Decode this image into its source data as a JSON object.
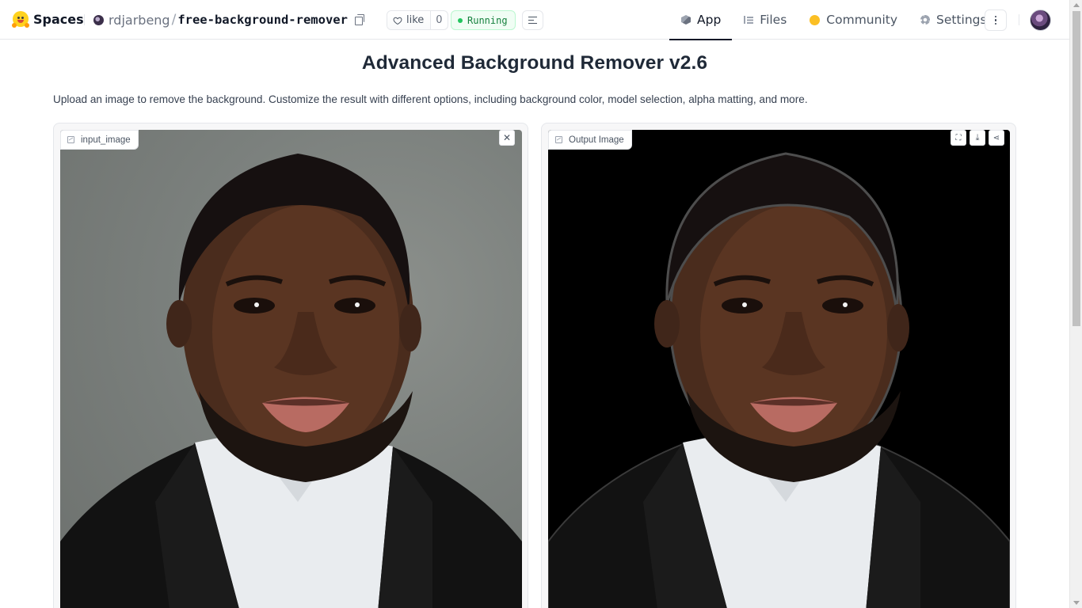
{
  "brand": {
    "name": "Spaces"
  },
  "repo": {
    "owner": "rdjarbeng",
    "separator": "/",
    "name": "free-background-remover"
  },
  "like": {
    "label": "like",
    "count": "0"
  },
  "status": {
    "label": "Running"
  },
  "tabs": [
    {
      "label": "App",
      "icon": "cube-icon",
      "active": true
    },
    {
      "label": "Files",
      "icon": "files-icon",
      "active": false
    },
    {
      "label": "Community",
      "icon": "community-icon",
      "active": false
    },
    {
      "label": "Settings",
      "icon": "gear-icon",
      "active": false
    }
  ],
  "app": {
    "title": "Advanced Background Remover v2.6",
    "description": "Upload an image to remove the background. Customize the result with different options, including background color, model selection, alpha matting, and more."
  },
  "input_panel": {
    "label": "input_image"
  },
  "output_panel": {
    "label": "Output Image"
  },
  "colors": {
    "accent": "#111827",
    "running": "#15803d",
    "output_bg": "#000000",
    "input_bg": "#7b807d"
  }
}
